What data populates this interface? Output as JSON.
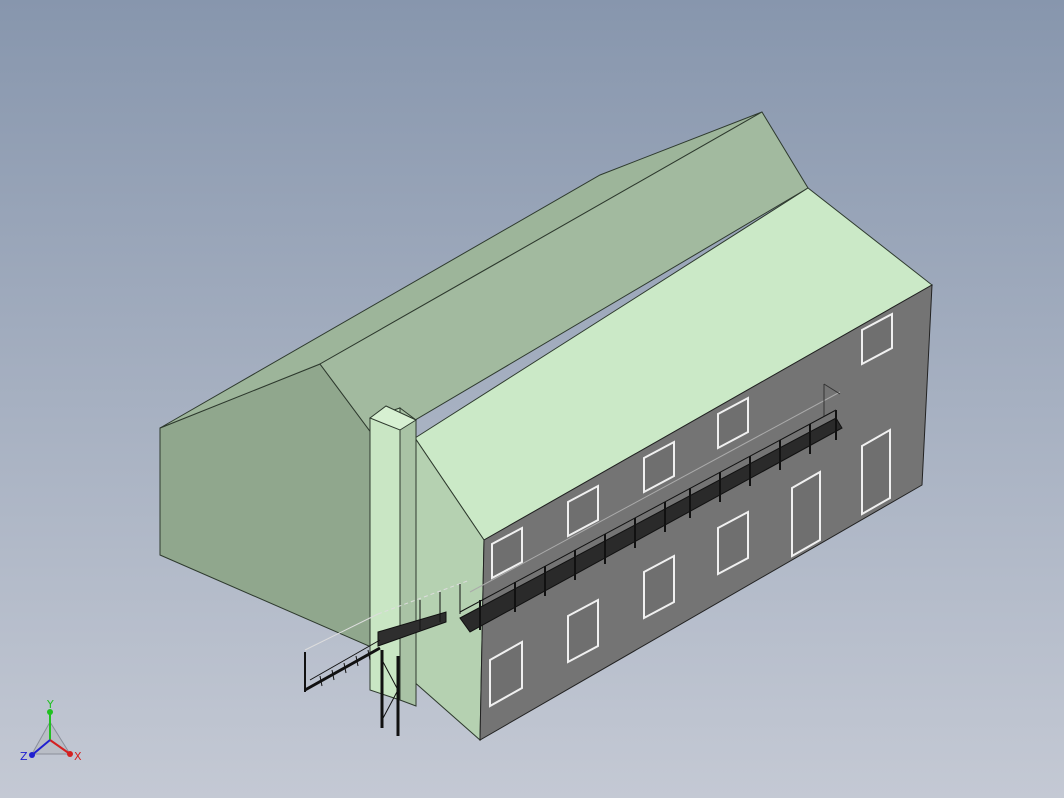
{
  "viewport": {
    "background_top": "#8796ad",
    "background_bottom": "#c4c9d4"
  },
  "model": {
    "wall_color": "#cce9c8",
    "roof_color": "#c5e7c3",
    "side_wall_color": "#a2b89e",
    "shadow_wall_color": "#7f9580",
    "gable_color": "#8ea58c",
    "front_wall_color": "#737373",
    "window_frame_color": "#f0f0f0",
    "walkway_color": "#1a1a1a"
  },
  "triad": {
    "x_label": "X",
    "y_label": "Y",
    "z_label": "Z",
    "x_color": "#d42020",
    "y_color": "#20c020",
    "z_color": "#2020d0"
  }
}
